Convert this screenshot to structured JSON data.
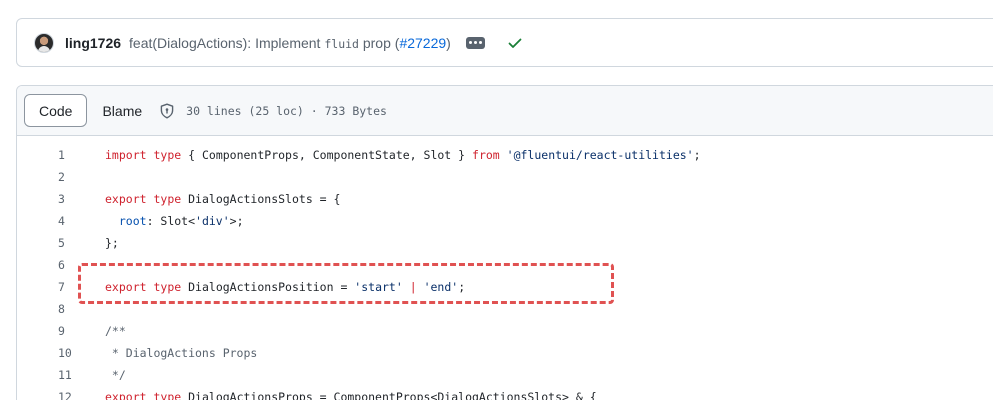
{
  "commit": {
    "author": "ling1726",
    "message_prefix": "feat(DialogActions): Implement ",
    "message_code": "fluid",
    "message_suffix_pre": " prop (",
    "pr_link": "#27229",
    "message_suffix_post": ")",
    "status": "success",
    "status_color": "#1a7f37"
  },
  "file_header": {
    "tab_code": "Code",
    "tab_blame": "Blame",
    "meta": "30 lines (25 loc) · 733 Bytes"
  },
  "code_lines": [
    {
      "n": "1"
    },
    {
      "n": "2"
    },
    {
      "n": "3"
    },
    {
      "n": "4"
    },
    {
      "n": "5"
    },
    {
      "n": "6"
    },
    {
      "n": "7"
    },
    {
      "n": "8"
    },
    {
      "n": "9"
    },
    {
      "n": "10"
    },
    {
      "n": "11"
    },
    {
      "n": "12"
    }
  ],
  "code": {
    "l1": [
      "import",
      "type",
      "{ ComponentProps, ComponentState, Slot }",
      "from",
      "'@fluentui/react-utilities'",
      ";"
    ],
    "l3": [
      "export",
      "type",
      "DialogActionsSlots = {"
    ],
    "l4": [
      "root",
      ": Slot<",
      "'div'",
      ">;"
    ],
    "l5": "};",
    "l7": [
      "export",
      "type",
      "DialogActionsPosition = ",
      "'start'",
      "|",
      "'end'",
      ";"
    ],
    "l9": "/**",
    "l10": " * DialogActions Props",
    "l11": " */",
    "l12": [
      "export",
      "type",
      "DialogActionsProps = ComponentProps<DialogActionsSlots> & {"
    ]
  },
  "colors": {
    "keyword": "#cf222e",
    "string": "#0a3069",
    "entity": "#0550ae",
    "annotation_border": "#e05252"
  }
}
